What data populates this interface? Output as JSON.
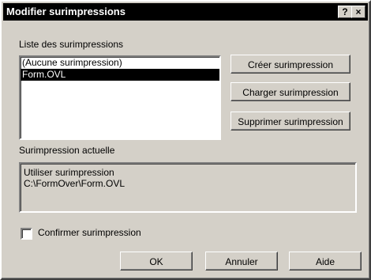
{
  "window": {
    "title": "Modifier surimpressions",
    "help_glyph": "?",
    "close_glyph": "×"
  },
  "overlay_list": {
    "label": "Liste des surimpressions",
    "items": [
      {
        "label": "(Aucune surimpression)",
        "selected": false
      },
      {
        "label": "Form.OVL",
        "selected": true
      }
    ]
  },
  "actions": {
    "create_label": "Créer surimpression",
    "load_label": "Charger surimpression",
    "delete_label": "Supprimer surimpression"
  },
  "current_overlay": {
    "label": "Surimpression actuelle",
    "line1": "Utiliser surimpression",
    "line2": "C:\\FormOver\\Form.OVL"
  },
  "confirm": {
    "label": "Confirmer surimpression",
    "checked": false
  },
  "footer": {
    "ok_label": "OK",
    "cancel_label": "Annuler",
    "help_label": "Aide"
  }
}
